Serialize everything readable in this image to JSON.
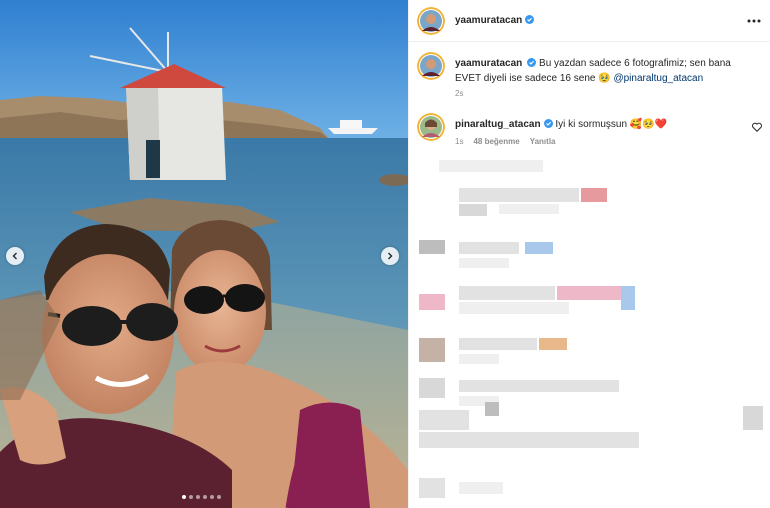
{
  "post": {
    "author": "yaamuratacan",
    "verified": true,
    "more_icon": "more-horizontal-icon"
  },
  "caption": {
    "username": "yaamuratacan",
    "text": "Bu yazdan sadece 6 fotografimiz; sen bana EVET diyeli ise sadece 16 sene 🥹",
    "mention": "@pinaraltug_atacan",
    "time": "2s"
  },
  "comment": {
    "username": "pinaraltug_atacan",
    "text": "Iyi ki sormuşsun 🥰🥺❤️",
    "time": "1s",
    "likes": "48 beğenme",
    "reply": "Yanıtla",
    "like_icon": "heart-outline-icon"
  },
  "carousel": {
    "prev_icon": "chevron-left-icon",
    "next_icon": "chevron-right-icon",
    "slides": 6,
    "active_slide": 1
  },
  "colors": {
    "verified": "#3897f0",
    "mention": "#00376b",
    "muted": "#8e8e8e"
  }
}
